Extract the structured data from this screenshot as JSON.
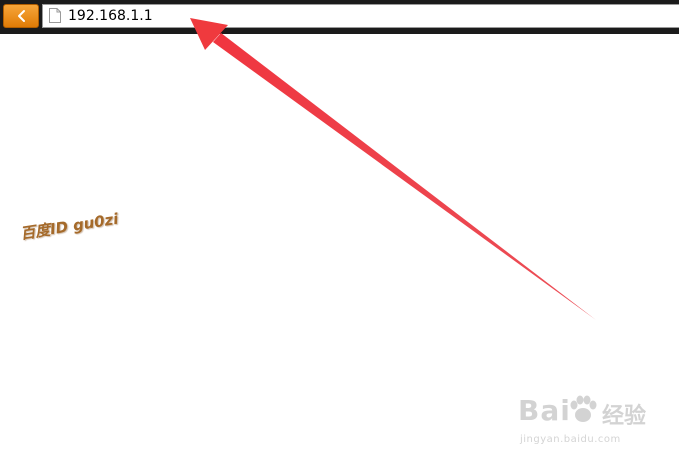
{
  "browser": {
    "address_url": "192.168.1.1",
    "back_icon": "chevron-left-icon",
    "page_icon": "page-icon",
    "accent_color": "#e88a12"
  },
  "annotation": {
    "arrow_color": "#e8303a",
    "author_text": "百度ID gu0zi",
    "author_color": "#a56a2a"
  },
  "watermark": {
    "brand_word": "Bai",
    "brand_cn": "经验",
    "brand_url": "jingyan.baidu.com"
  }
}
